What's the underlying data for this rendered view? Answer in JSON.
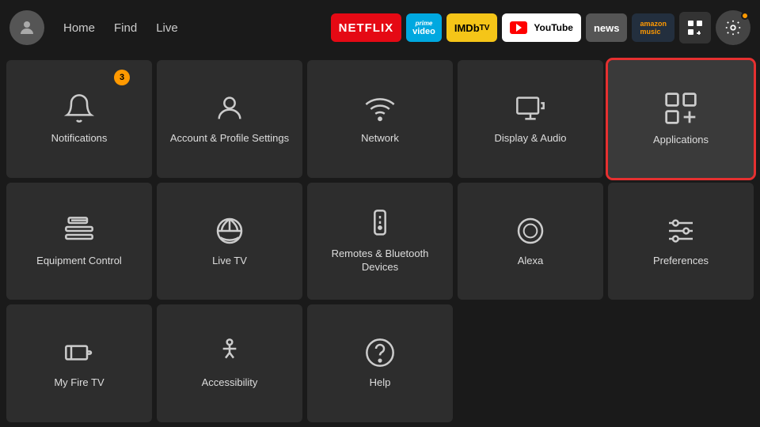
{
  "topbar": {
    "nav_links": [
      "Home",
      "Find",
      "Live"
    ],
    "apps": [
      {
        "name": "Netflix",
        "class": "badge-netflix",
        "label": "NETFLIX"
      },
      {
        "name": "Prime Video",
        "class": "badge-prime",
        "label": "prime video"
      },
      {
        "name": "IMDb TV",
        "class": "badge-imdb",
        "label": "IMDb TV"
      },
      {
        "name": "YouTube",
        "class": "badge-youtube",
        "label": "YouTube"
      },
      {
        "name": "News",
        "class": "badge-news",
        "label": "news"
      },
      {
        "name": "Amazon Music",
        "class": "badge-music",
        "label": "amazon music"
      }
    ]
  },
  "grid": {
    "items": [
      {
        "id": "notifications",
        "label": "Notifications",
        "badge": "3"
      },
      {
        "id": "account-profile",
        "label": "Account & Profile Settings",
        "badge": ""
      },
      {
        "id": "network",
        "label": "Network",
        "badge": ""
      },
      {
        "id": "display-audio",
        "label": "Display & Audio",
        "badge": ""
      },
      {
        "id": "applications",
        "label": "Applications",
        "badge": "",
        "selected": true
      },
      {
        "id": "equipment-control",
        "label": "Equipment Control",
        "badge": ""
      },
      {
        "id": "live-tv",
        "label": "Live TV",
        "badge": ""
      },
      {
        "id": "remotes-bluetooth",
        "label": "Remotes & Bluetooth Devices",
        "badge": ""
      },
      {
        "id": "alexa",
        "label": "Alexa",
        "badge": ""
      },
      {
        "id": "preferences",
        "label": "Preferences",
        "badge": ""
      },
      {
        "id": "my-fire-tv",
        "label": "My Fire TV",
        "badge": ""
      },
      {
        "id": "accessibility",
        "label": "Accessibility",
        "badge": ""
      },
      {
        "id": "help",
        "label": "Help",
        "badge": ""
      },
      {
        "id": "empty1",
        "label": "",
        "badge": ""
      },
      {
        "id": "empty2",
        "label": "",
        "badge": ""
      }
    ]
  }
}
